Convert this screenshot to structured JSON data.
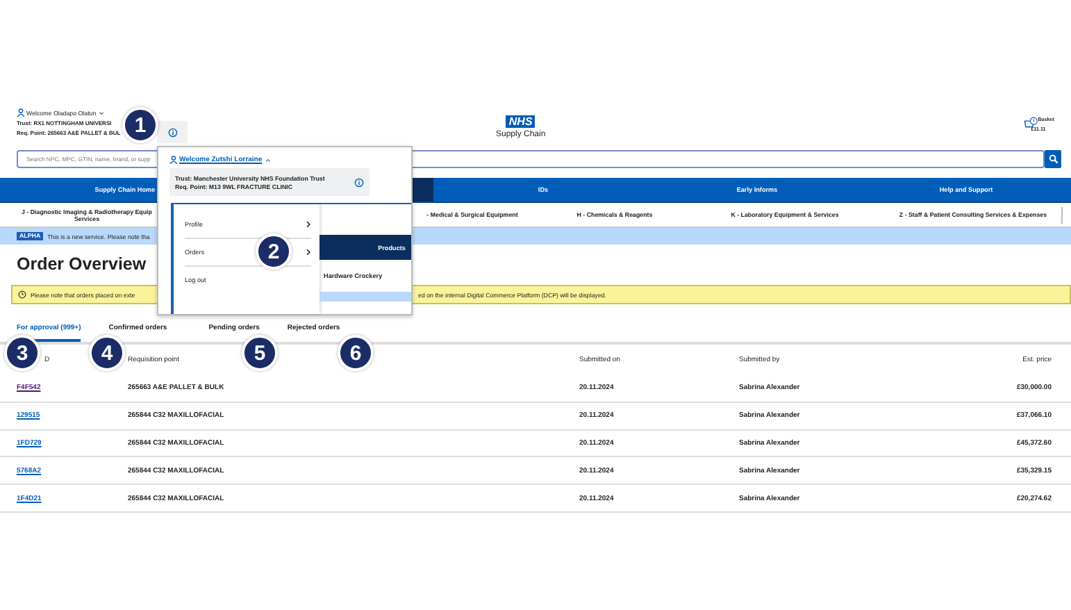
{
  "header": {
    "welcome": "Welcome Oladapo Olatun",
    "trust": "Trust: RX1 NOTTINGHAM UNIVERSI",
    "req_point": "Req. Point: 265663 A&E PALLET & BUL",
    "logo": "NHS",
    "logo_subtitle": "Supply Chain",
    "basket_label": "Basket",
    "basket_total": "£11.11"
  },
  "search": {
    "placeholder": "Search NPC, MPC, GTIN, name, brand, or supp"
  },
  "nav": [
    {
      "label": "Supply Chain Home",
      "selected": false
    },
    {
      "selected": true
    },
    {
      "label": "IDs",
      "selected": false
    },
    {
      "label": "Early Informs",
      "selected": false
    },
    {
      "label": "Help and Support",
      "selected": false
    }
  ],
  "categories": [
    {
      "lines": [
        "J - Diagnostic Imaging & Radiotherapy Equip",
        "Services"
      ]
    },
    {
      "lines": [
        "- Medical & Surgical Equipment"
      ]
    },
    {
      "lines": [
        "H - Chemicals & Reagents"
      ]
    },
    {
      "lines": [
        "K - Laboratory Equipment & Services"
      ]
    },
    {
      "lines": [
        "Z - Staff & Patient Consulting Services & Expenses"
      ]
    }
  ],
  "banner": {
    "tag": "ALPHA",
    "text": "This is a new service. Please note tha"
  },
  "title": "Order Overview",
  "notice": {
    "text_before": "Please note that orders placed on exte",
    "text_after": "ed on the internal Digital Commerce Platform (DCP) will be displayed."
  },
  "tabs": [
    {
      "label": "For approval (999+)",
      "selected": true
    },
    {
      "label": "Confirmed orders",
      "selected": false
    },
    {
      "label": "Pending orders",
      "selected": false
    },
    {
      "label": "Rejected orders",
      "selected": false
    }
  ],
  "table": {
    "columns": [
      "D",
      "Requisition point",
      "Submitted on",
      "Submitted by",
      "Est. price"
    ],
    "rows": [
      {
        "id": "F4F542",
        "visited": true,
        "point": "265663 A&E PALLET & BULK",
        "date": "20.11.2024",
        "by": "Sabrina Alexander",
        "price": "£30,000.00"
      },
      {
        "id": "129515",
        "visited": false,
        "point": "265844 C32 MAXILLOFACIAL",
        "date": "20.11.2024",
        "by": "Sabrina Alexander",
        "price": "£37,066.10"
      },
      {
        "id": "1FD729",
        "visited": false,
        "point": "265844 C32 MAXILLOFACIAL",
        "date": "20.11.2024",
        "by": "Sabrina Alexander",
        "price": "£45,372.60"
      },
      {
        "id": "5768A2",
        "visited": false,
        "point": "265844 C32 MAXILLOFACIAL",
        "date": "20.11.2024",
        "by": "Sabrina Alexander",
        "price": "£35,329.15"
      },
      {
        "id": "1F4D21",
        "visited": false,
        "point": "265844 C32 MAXILLOFACIAL",
        "date": "20.11.2024",
        "by": "Sabrina Alexander",
        "price": "£20,274.62"
      }
    ]
  },
  "account_menu": {
    "welcome": "Welcome Zutshi Lorraine",
    "trust": "Trust: Manchester University NHS Foundation Trust",
    "req_point": "Req. Point: M13 9WL FRACTURE CLINIC",
    "items": [
      {
        "label": "Profile",
        "chevron": true
      },
      {
        "label": "Orders",
        "chevron": true
      },
      {
        "label": "Log out",
        "chevron": false
      }
    ],
    "products_heading": "Products",
    "product": "Hardware Crockery"
  },
  "callouts": [
    "1",
    "2",
    "3",
    "4",
    "5",
    "6"
  ]
}
